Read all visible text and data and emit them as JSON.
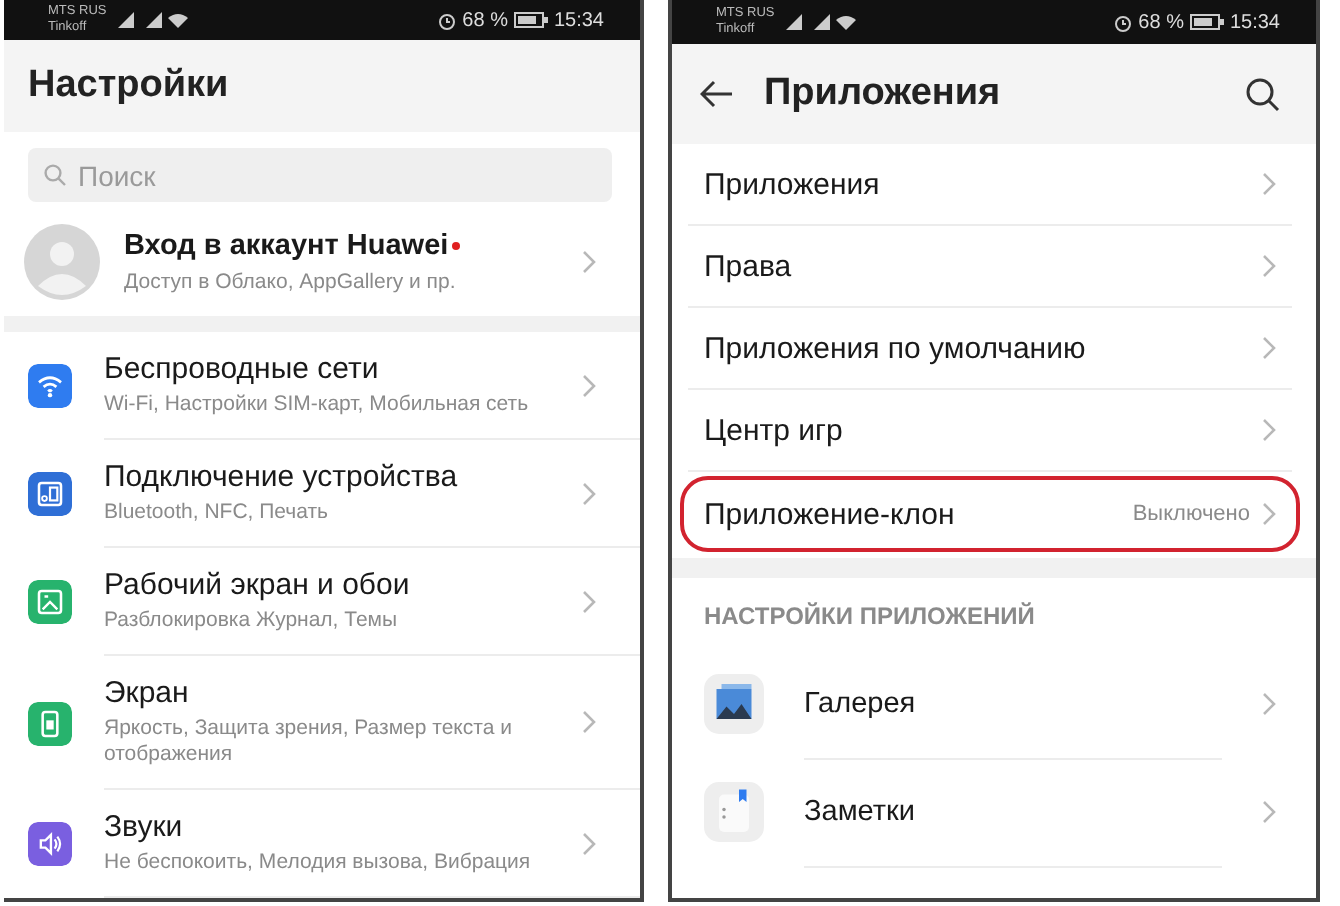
{
  "left_screen": {
    "status_bar": {
      "carrier_1": "MTS RUS",
      "carrier_2": "Tinkoff",
      "battery": "68 %",
      "time": "15:34"
    },
    "title": "Настройки",
    "search": {
      "placeholder": "Поиск"
    },
    "account": {
      "title": "Вход в аккаунт Huawei",
      "subtitle": "Доступ в Облако, AppGallery и пр.",
      "notification_dot": true
    },
    "items": [
      {
        "title": "Беспроводные сети",
        "subtitle": "Wi-Fi, Настройки SIM-карт, Мобильная сеть",
        "color": "#2f7cf0"
      },
      {
        "title": "Подключение устройства",
        "subtitle": "Bluetooth, NFC, Печать",
        "color": "#2f6fd6"
      },
      {
        "title": "Рабочий экран и обои",
        "subtitle": "Разблокировка Журнал, Темы",
        "color": "#27b36d"
      },
      {
        "title": "Экран",
        "subtitle": "Яркость, Защита зрения, Размер текста и отображения",
        "color": "#27b36d"
      },
      {
        "title": "Звуки",
        "subtitle": "Не беспокоить, Мелодия вызова, Вибрация",
        "color": "#7a5fe0"
      }
    ]
  },
  "right_screen": {
    "status_bar": {
      "carrier_1": "MTS RUS",
      "carrier_2": "Tinkoff",
      "battery": "68 %",
      "time": "15:34"
    },
    "title": "Приложения",
    "items": [
      {
        "title": "Приложения",
        "highlighted": false
      },
      {
        "title": "Права",
        "highlighted": false
      },
      {
        "title": "Приложения по умолчанию",
        "highlighted": false
      },
      {
        "title": "Центр игр",
        "highlighted": false
      },
      {
        "title": "Приложение-клон",
        "value": "Выключено",
        "highlighted": true
      }
    ],
    "section_title": "НАСТРОЙКИ ПРИЛОЖЕНИЙ",
    "apps": [
      {
        "title": "Галерея"
      },
      {
        "title": "Заметки"
      }
    ]
  }
}
